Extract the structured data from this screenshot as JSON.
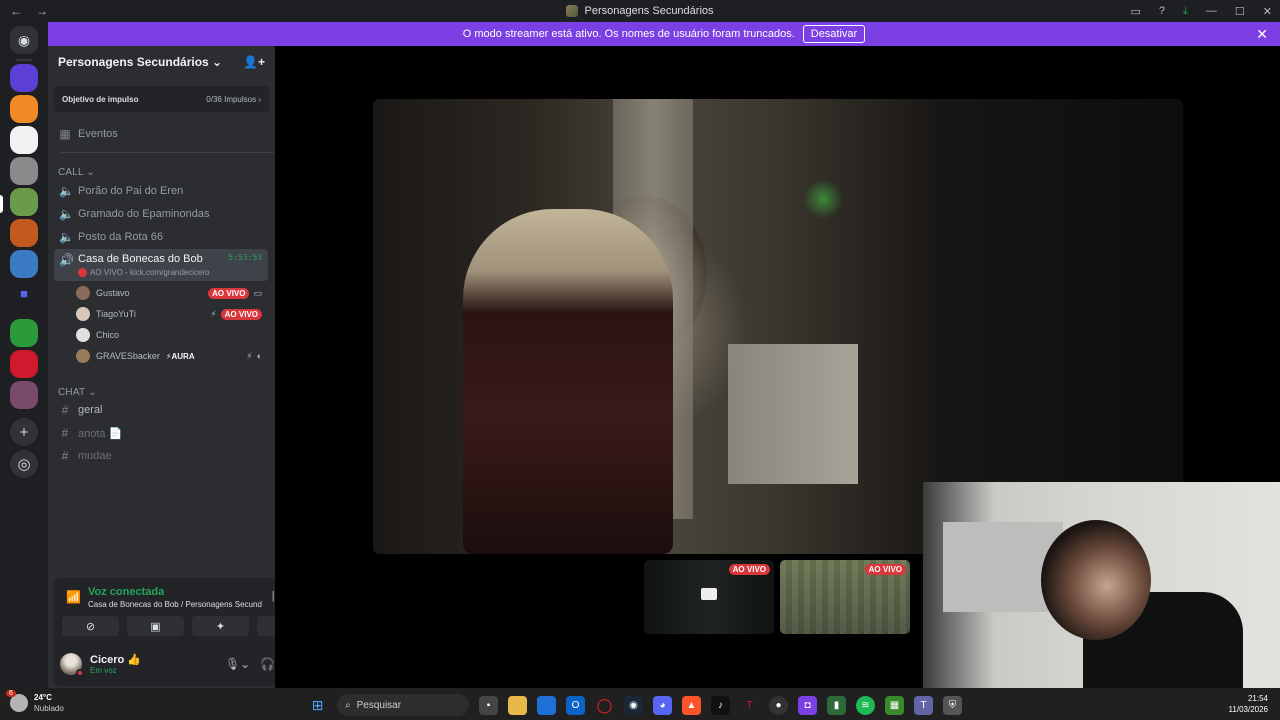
{
  "window": {
    "title": "Personagens Secundários",
    "back": "←",
    "fwd": "→"
  },
  "banner": {
    "text": "O modo streamer está ativo. Os nomes de usuário foram truncados.",
    "button": "Desativar"
  },
  "guild": {
    "name": "Personagens Secundários ⌄",
    "boost_label": "Objetivo de impulso",
    "boost_value": "0/36 Impulsos",
    "events": "Eventos",
    "cat_call": "CALL ⌄",
    "voice_channels": [
      "Porão do Pai do Eren",
      "Gramado do Epaminondas",
      "Posto da Rota 66",
      "Casa de Bonecas do Bob"
    ],
    "active_timer": "5:53:53",
    "active_sub": "AO VIVO - kick.com/grandecicero",
    "members": [
      {
        "name": "Gustavo",
        "live": "AO VIVO"
      },
      {
        "name": "TiagoYuTi",
        "live": "AO VIVO"
      },
      {
        "name": "Chico"
      },
      {
        "name": "GRAVESbacker",
        "tag": "AURA"
      }
    ],
    "cat_chat": "CHAT ⌄",
    "text_channels": [
      "geral",
      "anota 📄",
      "mudae"
    ]
  },
  "voice_panel": {
    "status": "Voz conectada",
    "location": "Casa de Bonecas do Bob / Personagens Secund..."
  },
  "user": {
    "name": "Cicero 👍",
    "status": "Em voz"
  },
  "stage": {
    "thumb_live_1": "AO VIVO",
    "thumb_live_2": "AO VIVO"
  },
  "taskbar": {
    "weather_temp": "24°C",
    "weather_desc": "Nublado",
    "notif_count": "6",
    "search_placeholder": "Pesquisar",
    "time": "21:54",
    "date": "11/03/2026"
  },
  "colors": {
    "accent": "#7b3fe4",
    "live": "#da373c",
    "connected": "#23a55a"
  }
}
